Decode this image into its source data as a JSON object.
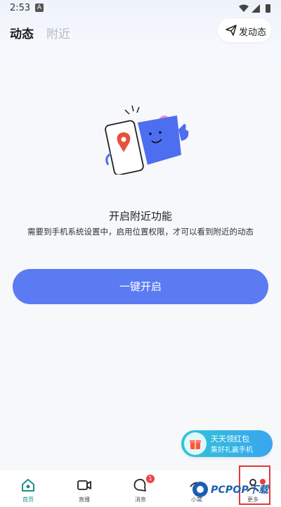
{
  "status_bar": {
    "time": "2:53",
    "notif_letter": "A"
  },
  "header": {
    "tabs": [
      {
        "label": "动态"
      },
      {
        "label": "附近"
      }
    ],
    "post_button": "发动态"
  },
  "empty_state": {
    "title": "开启附近功能",
    "description": "需要到手机系统设置中，启用位置权限，才可以看到附近的动态",
    "action": "一键开启"
  },
  "promo": {
    "line1": "天天领红包",
    "line2": "集好礼赢手机"
  },
  "bottom_nav": {
    "items": [
      {
        "label": "首页",
        "icon": "home-icon",
        "active": true
      },
      {
        "label": "直播",
        "icon": "video-icon"
      },
      {
        "label": "消息",
        "icon": "message-icon",
        "badge": "1"
      },
      {
        "label": "小窝",
        "icon": "nest-icon"
      },
      {
        "label": "更多",
        "icon": "profile-icon",
        "dot": true
      }
    ]
  },
  "watermark": "PCPOP下载",
  "colors": {
    "primary": "#5b7bf2",
    "active_tab": "#1f8d86",
    "badge": "#ee4444"
  }
}
